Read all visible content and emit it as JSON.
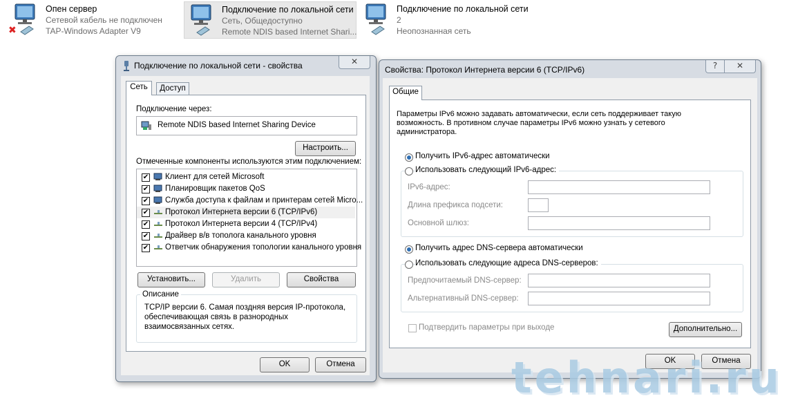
{
  "connections": [
    {
      "name": "Опен сервер",
      "status": "Сетевой кабель не подключен",
      "device": "TAP-Windows Adapter V9",
      "error": true,
      "selected": false
    },
    {
      "name": "Подключение по локальной сети",
      "status": "Сеть, Общедоступно",
      "device": "Remote NDIS based Internet Shari...",
      "error": false,
      "selected": true
    },
    {
      "name": "Подключение по локальной сети",
      "status": "2",
      "device": "Неопознанная сеть",
      "error": false,
      "selected": false
    }
  ],
  "props_dialog": {
    "title": "Подключение по локальной сети - свойства",
    "tabs": [
      "Сеть",
      "Доступ"
    ],
    "connect_via_label": "Подключение через:",
    "adapter": "Remote NDIS based Internet Sharing Device",
    "configure_button": "Настроить...",
    "components_label": "Отмеченные компоненты используются этим подключением:",
    "components": [
      {
        "label": "Клиент для сетей Microsoft",
        "checked": true,
        "icon": "network-client-icon"
      },
      {
        "label": "Планировщик пакетов QoS",
        "checked": true,
        "icon": "scheduler-icon"
      },
      {
        "label": "Служба доступа к файлам и принтерам сетей Micro...",
        "checked": true,
        "icon": "file-sharing-icon"
      },
      {
        "label": "Протокол Интернета версии 6 (TCP/IPv6)",
        "checked": true,
        "icon": "protocol-icon"
      },
      {
        "label": "Протокол Интернета версии 4 (TCP/IPv4)",
        "checked": true,
        "icon": "protocol-icon"
      },
      {
        "label": "Драйвер в/в тополога канального уровня",
        "checked": true,
        "icon": "protocol-icon"
      },
      {
        "label": "Ответчик обнаружения топологии канального уровня",
        "checked": true,
        "icon": "protocol-icon"
      }
    ],
    "install_button": "Установить...",
    "remove_button": "Удалить",
    "properties_button": "Свойства",
    "description_title": "Описание",
    "description_text": "TCP/IP версии 6. Самая поздняя версия IP-протокола,\nобеспечивающая связь в разнородных\nвзаимосвязанных сетях.",
    "ok_button": "OK",
    "cancel_button": "Отмена"
  },
  "ipv6_dialog": {
    "title": "Свойства: Протокол Интернета версии 6 (TCP/IPv6)",
    "help": "?",
    "tab": "Общие",
    "intro": "Параметры IPv6 можно задавать автоматически, если сеть поддерживает такую\nвозможность. В противном случае параметры IPv6 можно узнать у сетевого\nадминистратора.",
    "radio_auto_ip": "Получить IPv6-адрес автоматически",
    "radio_manual_ip": "Использовать следующий IPv6-адрес:",
    "ipv6_address_label": "IPv6-адрес:",
    "prefix_label": "Длина префикса подсети:",
    "gateway_label": "Основной шлюз:",
    "ipv6_address_value": "",
    "prefix_value": "",
    "gateway_value": "",
    "radio_auto_dns": "Получить адрес DNS-сервера автоматически",
    "radio_manual_dns": "Использовать следующие адреса DNS-серверов:",
    "preferred_dns_label": "Предпочитаемый DNS-сервер:",
    "alternate_dns_label": "Альтернативный DNS-сервер:",
    "preferred_dns_value": "",
    "alternate_dns_value": "",
    "validate_label": "Подтвердить параметры при выходе",
    "advanced_button": "Дополнительно...",
    "ok_button": "OK",
    "cancel_button": "Отмена"
  },
  "watermark": "tehnari.ru",
  "colors": {
    "radio_dot": "#2f6fb3",
    "window_frame": "#d7dce3",
    "watermark": "#a9cbe3"
  }
}
